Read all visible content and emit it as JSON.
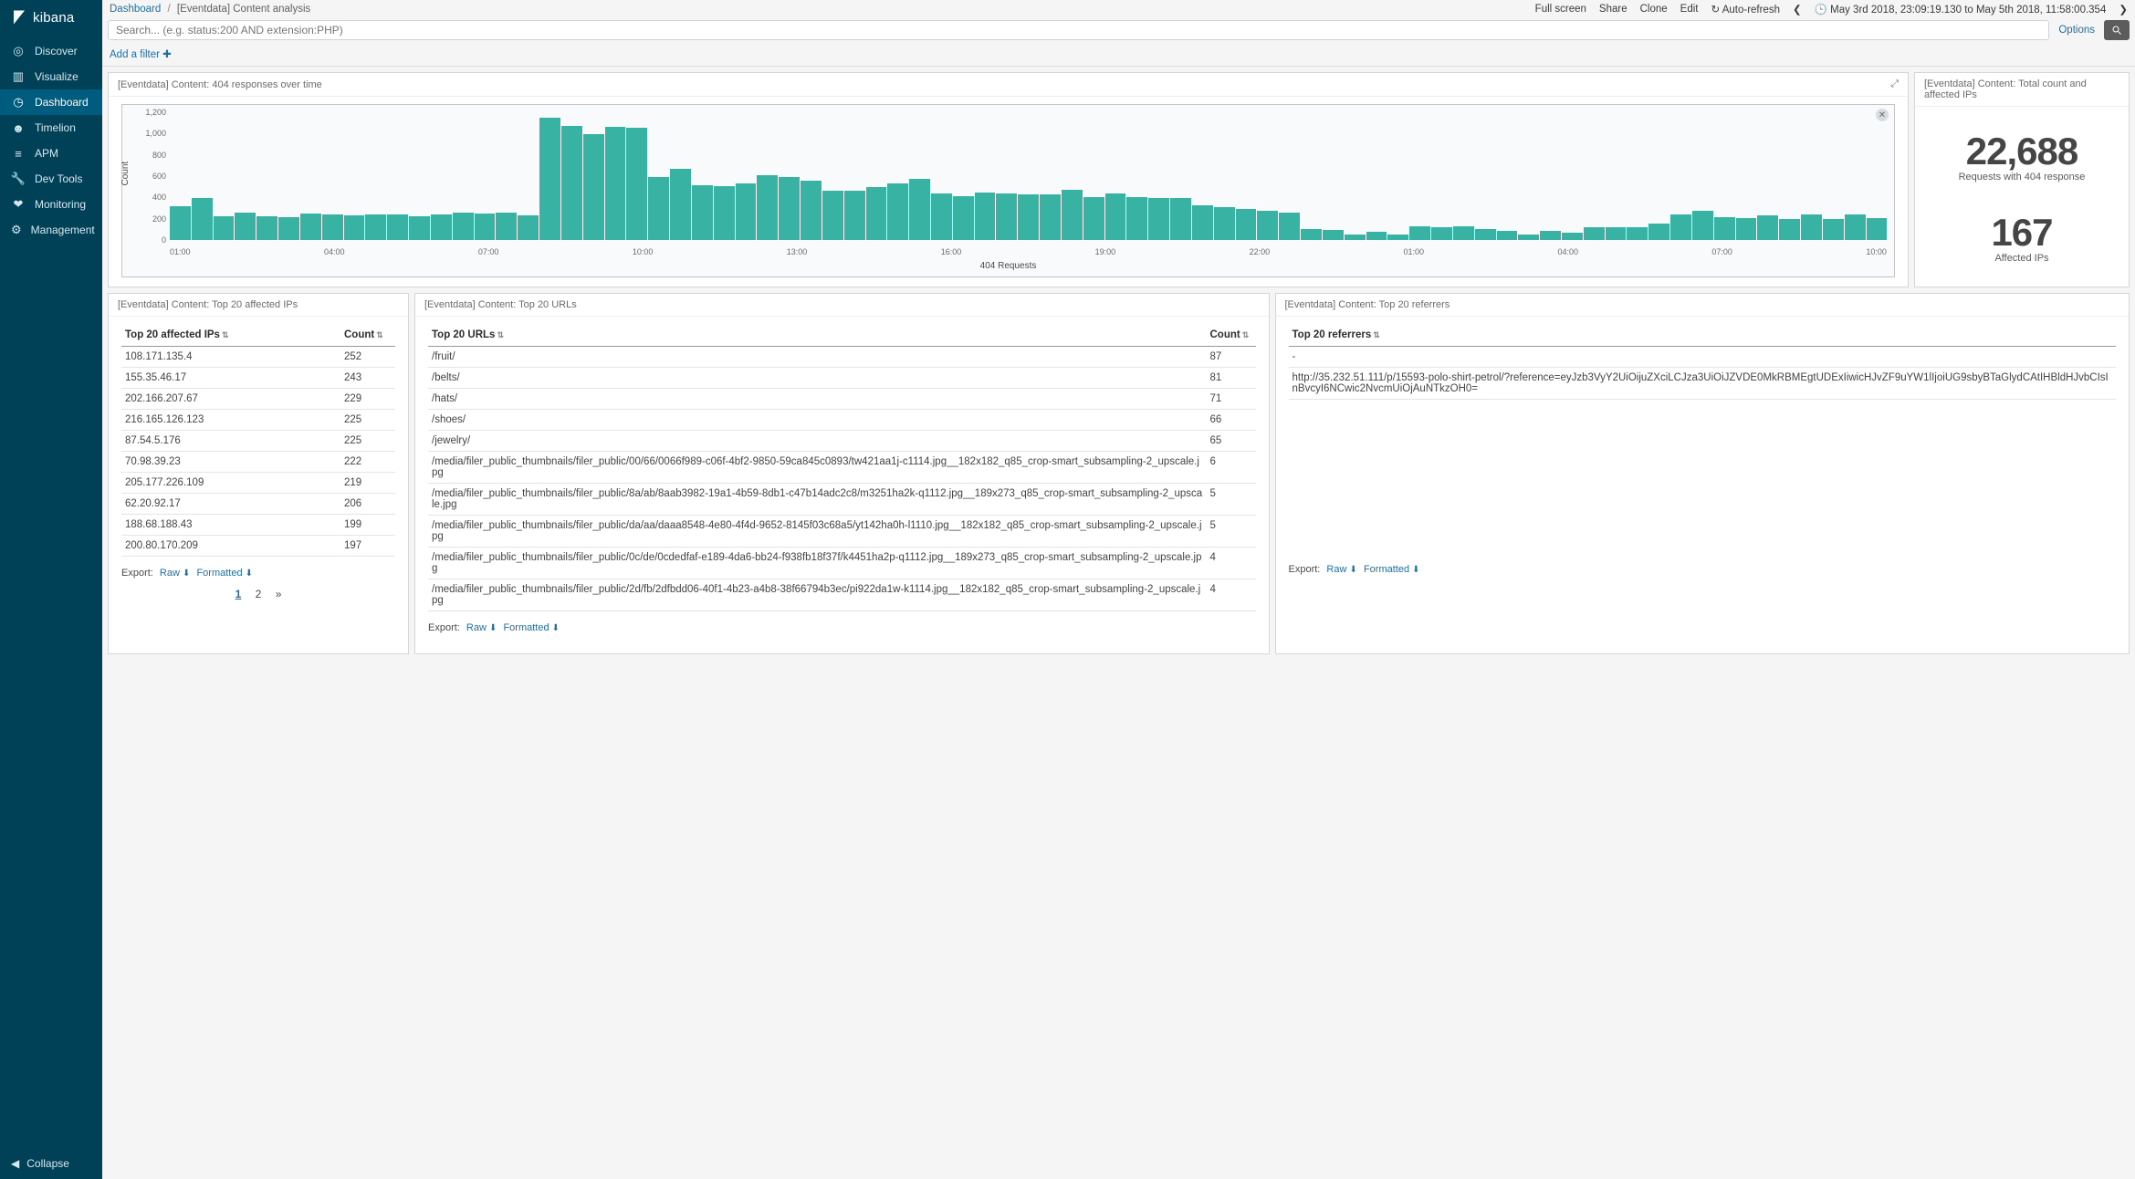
{
  "brand": "kibana",
  "sidebar": {
    "items": [
      {
        "icon": "compass",
        "label": "Discover"
      },
      {
        "icon": "bar",
        "label": "Visualize"
      },
      {
        "icon": "gauge",
        "label": "Dashboard",
        "active": true
      },
      {
        "icon": "badge",
        "label": "Timelion"
      },
      {
        "icon": "apm",
        "label": "APM"
      },
      {
        "icon": "wrench",
        "label": "Dev Tools"
      },
      {
        "icon": "heart",
        "label": "Monitoring"
      },
      {
        "icon": "gear",
        "label": "Management"
      }
    ],
    "collapse": "Collapse"
  },
  "breadcrumb": {
    "root": "Dashboard",
    "current": "[Eventdata] Content analysis"
  },
  "top": {
    "fullscreen": "Full screen",
    "share": "Share",
    "clone": "Clone",
    "edit": "Edit",
    "autorefresh": "Auto-refresh",
    "timerange": "May 3rd 2018, 23:09:19.130 to May 5th 2018, 11:58:00.354"
  },
  "search": {
    "placeholder": "Search... (e.g. status:200 AND extension:PHP)",
    "options": "Options"
  },
  "filter": {
    "add": "Add a filter"
  },
  "panels": {
    "graph": {
      "title": "[Eventdata] Content: 404 responses over time"
    },
    "metrics": {
      "title": "[Eventdata] Content: Total count and affected IPs",
      "m1": {
        "value": "22,688",
        "label": "Requests with 404 response"
      },
      "m2": {
        "value": "167",
        "label": "Affected IPs"
      }
    },
    "ips": {
      "title": "[Eventdata] Content: Top 20 affected IPs",
      "col1": "Top 20 affected IPs",
      "col2": "Count",
      "rows": [
        {
          "k": "108.171.135.4",
          "v": "252"
        },
        {
          "k": "155.35.46.17",
          "v": "243"
        },
        {
          "k": "202.166.207.67",
          "v": "229"
        },
        {
          "k": "216.165.126.123",
          "v": "225"
        },
        {
          "k": "87.54.5.176",
          "v": "225"
        },
        {
          "k": "70.98.39.23",
          "v": "222"
        },
        {
          "k": "205.177.226.109",
          "v": "219"
        },
        {
          "k": "62.20.92.17",
          "v": "206"
        },
        {
          "k": "188.68.188.43",
          "v": "199"
        },
        {
          "k": "200.80.170.209",
          "v": "197"
        }
      ]
    },
    "urls": {
      "title": "[Eventdata] Content: Top 20 URLs",
      "col1": "Top 20 URLs",
      "col2": "Count",
      "rows": [
        {
          "k": "/fruit/",
          "v": "87"
        },
        {
          "k": "/belts/",
          "v": "81"
        },
        {
          "k": "/hats/",
          "v": "71"
        },
        {
          "k": "/shoes/",
          "v": "66"
        },
        {
          "k": "/jewelry/",
          "v": "65"
        },
        {
          "k": "/media/filer_public_thumbnails/filer_public/00/66/0066f989-c06f-4bf2-9850-59ca845c0893/tw421aa1j-c1114.jpg__182x182_q85_crop-smart_subsampling-2_upscale.jpg",
          "v": "6"
        },
        {
          "k": "/media/filer_public_thumbnails/filer_public/8a/ab/8aab3982-19a1-4b59-8db1-c47b14adc2c8/m3251ha2k-q1112.jpg__189x273_q85_crop-smart_subsampling-2_upscale.jpg",
          "v": "5"
        },
        {
          "k": "/media/filer_public_thumbnails/filer_public/da/aa/daaa8548-4e80-4f4d-9652-8145f03c68a5/yt142ha0h-l1110.jpg__182x182_q85_crop-smart_subsampling-2_upscale.jpg",
          "v": "5"
        },
        {
          "k": "/media/filer_public_thumbnails/filer_public/0c/de/0cdedfaf-e189-4da6-bb24-f938fb18f37f/k4451ha2p-q1112.jpg__189x273_q85_crop-smart_subsampling-2_upscale.jpg",
          "v": "4"
        },
        {
          "k": "/media/filer_public_thumbnails/filer_public/2d/fb/2dfbdd06-40f1-4b23-a4b8-38f66794b3ec/pi922da1w-k1114.jpg__182x182_q85_crop-smart_subsampling-2_upscale.jpg",
          "v": "4"
        }
      ]
    },
    "refs": {
      "title": "[Eventdata] Content: Top 20 referrers",
      "col1": "Top 20 referrers",
      "rows": [
        {
          "k": "-"
        },
        {
          "k": "http://35.232.51.111/p/15593-polo-shirt-petrol/?reference=eyJzb3VyY2UiOijuZXciLCJza3UiOiJZVDE0MkRBMEgtUDExIiwicHJvZF9uYW1lIjoiUG9sbyBTaGlydCAtIHBldHJvbCIsInBvcyI6NCwic2NvcmUiOjAuNTkzOH0="
        }
      ]
    }
  },
  "export": {
    "label": "Export:",
    "raw": "Raw",
    "formatted": "Formatted"
  },
  "pager": {
    "p1": "1",
    "p2": "2",
    "next": "»"
  },
  "chart_data": {
    "type": "bar",
    "title": "404 Requests",
    "ylabel": "Count",
    "ylim": [
      0,
      1300
    ],
    "yticks": [
      "0",
      "200",
      "400",
      "600",
      "800",
      "1,000",
      "1,200"
    ],
    "xticks": [
      "01:00",
      "04:00",
      "07:00",
      "10:00",
      "13:00",
      "16:00",
      "19:00",
      "22:00",
      "01:00",
      "04:00",
      "07:00",
      "10:00"
    ],
    "values": [
      340,
      430,
      240,
      280,
      240,
      230,
      270,
      260,
      250,
      260,
      260,
      240,
      260,
      280,
      270,
      280,
      250,
      1240,
      1160,
      1080,
      1150,
      1140,
      640,
      720,
      560,
      550,
      580,
      660,
      640,
      600,
      500,
      500,
      540,
      580,
      620,
      470,
      450,
      480,
      470,
      460,
      460,
      510,
      440,
      470,
      440,
      430,
      430,
      350,
      330,
      320,
      300,
      280,
      110,
      100,
      60,
      80,
      60,
      140,
      130,
      140,
      110,
      90,
      60,
      90,
      70,
      130,
      130,
      130,
      170,
      260,
      300,
      230,
      220,
      250,
      210,
      260,
      210,
      260,
      220
    ]
  }
}
